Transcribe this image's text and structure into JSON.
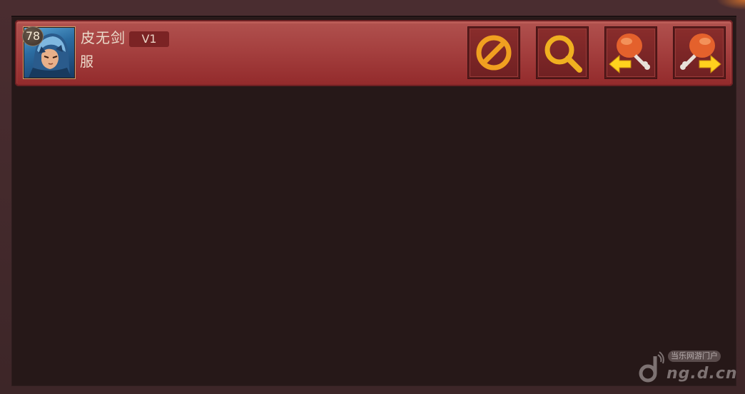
{
  "friend": {
    "level": "78",
    "name": "皮无剑",
    "vip": "V1",
    "server": "服"
  },
  "actions": [
    {
      "name": "block",
      "icon": "block-icon"
    },
    {
      "name": "search",
      "icon": "magnifier-icon"
    },
    {
      "name": "receive-stamina",
      "icon": "drumstick-arrow-left-icon"
    },
    {
      "name": "send-stamina",
      "icon": "drumstick-arrow-right-icon"
    }
  ],
  "watermark": {
    "tag": "当乐网游门户",
    "site": "ng.d.cn"
  },
  "colors": {
    "row_accent": "#a5403f",
    "icon_orange": "#f0a020",
    "arrow_yellow": "#ffd21e"
  }
}
